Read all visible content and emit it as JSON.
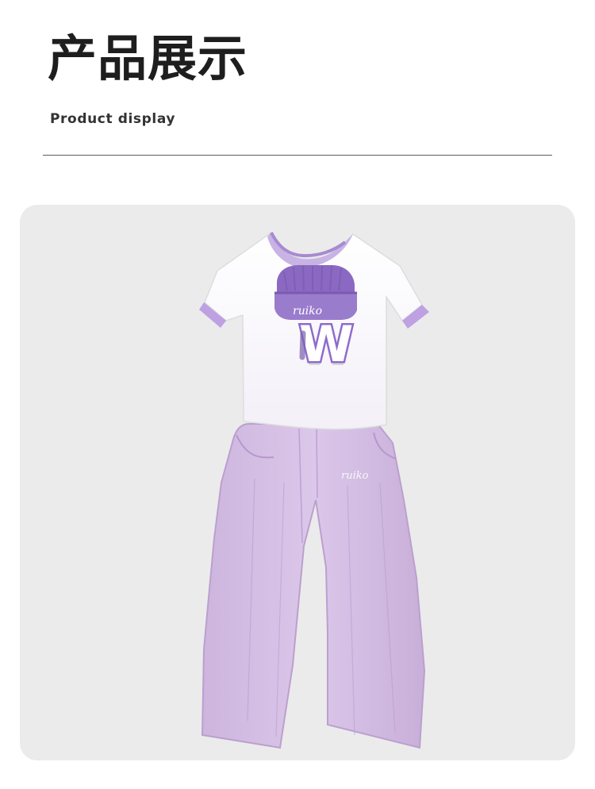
{
  "header": {
    "title": "产品展示",
    "subtitle": "Product display"
  },
  "product": {
    "shirt_graphic_letter": "W",
    "logo_script": "ruiko",
    "colors": {
      "panel_background": "#ebebeb",
      "shirt_body": "#f4f2fa",
      "trim_purple": "#b195d6",
      "hat_purple": "#8f6fc5",
      "pants_lilac": "#d3bde3",
      "text_dark": "#1e1e1e"
    }
  }
}
